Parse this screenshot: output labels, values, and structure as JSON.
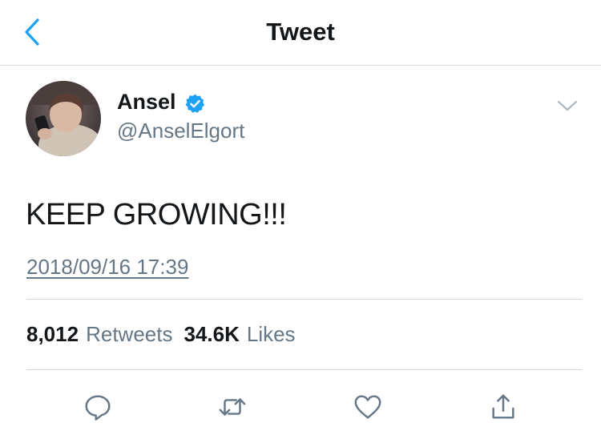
{
  "header": {
    "title": "Tweet"
  },
  "tweet": {
    "author_name": "Ansel",
    "handle": "@AnselElgort",
    "verified": true,
    "text": "KEEP GROWING!!!",
    "timestamp": "2018/09/16 17:39"
  },
  "stats": {
    "retweets_count": "8,012",
    "retweets_label": "Retweets",
    "likes_count": "34.6K",
    "likes_label": "Likes"
  },
  "colors": {
    "accent": "#1da1f2",
    "text": "#14171a",
    "secondary": "#657786",
    "divider": "#d6d9dc"
  },
  "icons": {
    "back": "chevron-left-icon",
    "verified": "verified-badge-icon",
    "more": "chevron-down-icon",
    "reply": "reply-icon",
    "retweet": "retweet-icon",
    "like": "heart-icon",
    "share": "share-icon"
  }
}
